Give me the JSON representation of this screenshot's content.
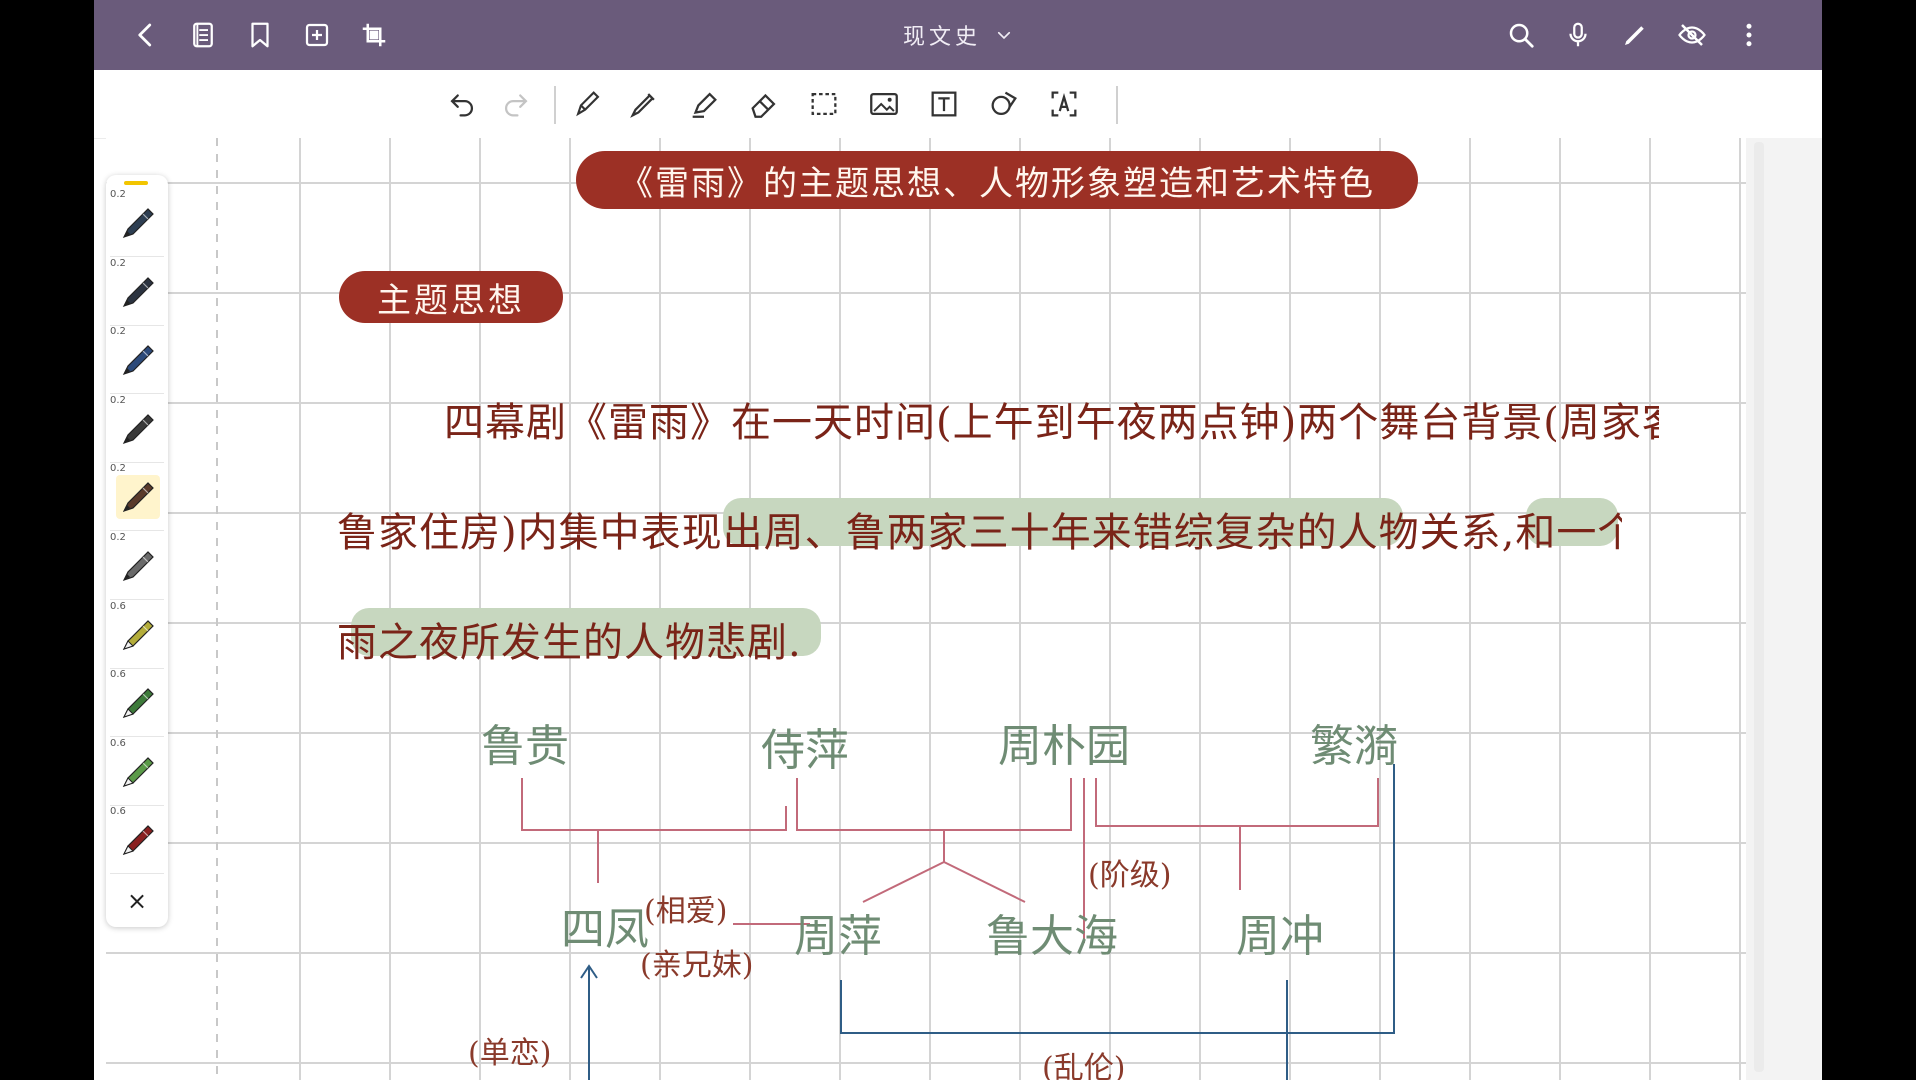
{
  "topbar": {
    "notebook_title": "现文史",
    "left_icons": [
      "back-icon",
      "notebook-icon",
      "bookmark-icon",
      "add-page-icon",
      "crop-icon"
    ],
    "right_icons": [
      "search-icon",
      "microphone-icon",
      "pen-icon",
      "eye-off-icon",
      "more-icon"
    ]
  },
  "toolbar": {
    "tools": [
      "undo-icon",
      "redo-icon",
      "pencil-icon",
      "fountain-pen-icon",
      "highlighter-icon",
      "eraser-icon",
      "lasso-select-icon",
      "image-icon",
      "text-box-icon",
      "shape-icon",
      "ocr-icon"
    ]
  },
  "palette": {
    "pens": [
      {
        "width": "0.2",
        "color": "#2d3e52"
      },
      {
        "width": "0.2",
        "color": "#2b3340"
      },
      {
        "width": "0.2",
        "color": "#2c4a7a"
      },
      {
        "width": "0.2",
        "color": "#3a3a3a"
      },
      {
        "width": "0.2",
        "color": "#5a3a2a"
      },
      {
        "width": "0.2",
        "color": "#6a6a6a"
      },
      {
        "width": "0.6",
        "color": "#b4ad3a"
      },
      {
        "width": "0.6",
        "color": "#3d7a3a"
      },
      {
        "width": "0.6",
        "color": "#5a9a48"
      },
      {
        "width": "0.6",
        "color": "#8a2020"
      }
    ],
    "close_label": "×"
  },
  "note": {
    "title": "《雷雨》的主题思想、人物形象塑造和艺术特色",
    "section": "主题思想",
    "para_line1": "四幕剧《雷雨》在一天时间(上午到午夜两点钟)两个舞台背景(周家客厅和",
    "para_line2": "鲁家住房)内集中表现出周、鲁两家三十年来错综复杂的人物关系,和一个在雷",
    "para_line3": "雨之夜所发生的人物悲剧.",
    "names": {
      "lugui": "鲁贵",
      "shiping": "侍萍",
      "zhoupuyuan": "周朴园",
      "fanyi": "繁漪",
      "sifeng": "四凤",
      "zhouping": "周萍",
      "ludahai": "鲁大海",
      "zhouchong": "周冲"
    },
    "labels": {
      "xiangai": "(相爱)",
      "qinxiongmei": "(亲兄妹)",
      "jieji": "(阶级)",
      "danlian": "(单恋)",
      "luanlun": "(乱伦)"
    }
  },
  "colors": {
    "topbar": "#6a5b7b",
    "banner": "#9c3025",
    "handwriting": "#7a2418",
    "highlight": "#c7d7bf",
    "names": "#6f8c74",
    "line_red": "#c26a7a",
    "line_blue": "#2f5d86",
    "grid": "#d4d4d4"
  }
}
